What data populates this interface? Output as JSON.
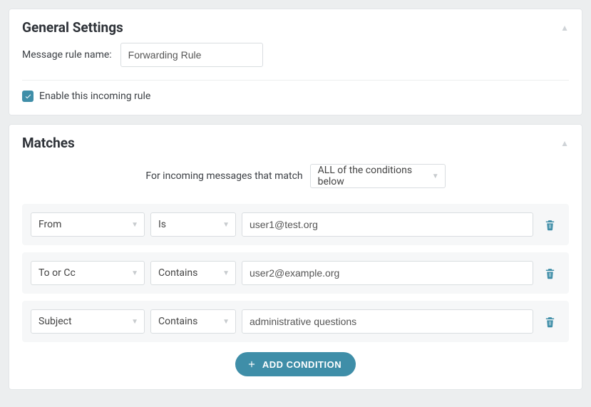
{
  "general": {
    "title": "General Settings",
    "rule_name_label": "Message rule name:",
    "rule_name_value": "Forwarding Rule",
    "enable_label": "Enable this incoming rule",
    "enable_checked": true
  },
  "matches": {
    "title": "Matches",
    "intro_text": "For incoming messages that match",
    "mode_value": "ALL of the conditions below",
    "add_button": "ADD CONDITION",
    "conditions": [
      {
        "field": "From",
        "operator": "Is",
        "value": "user1@test.org"
      },
      {
        "field": "To or Cc",
        "operator": "Contains",
        "value": "user2@example.org"
      },
      {
        "field": "Subject",
        "operator": "Contains",
        "value": "administrative questions"
      }
    ]
  }
}
